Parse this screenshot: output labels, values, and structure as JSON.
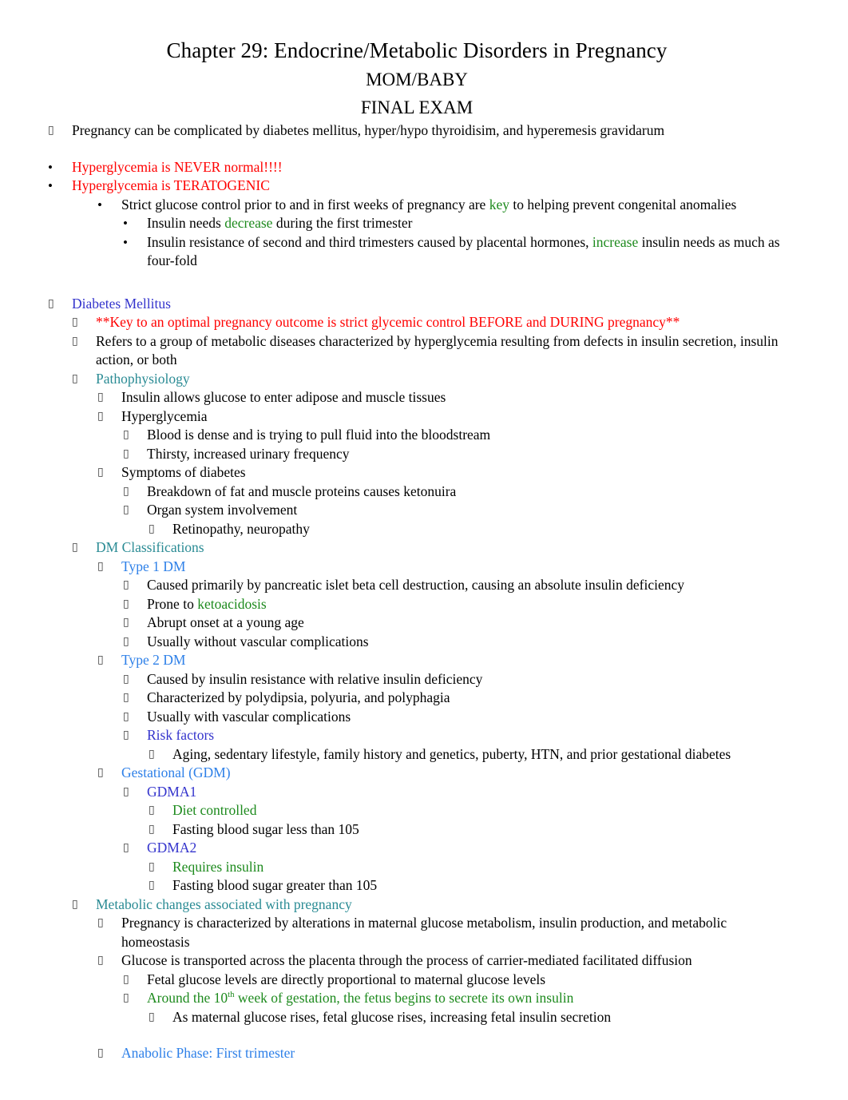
{
  "document": {
    "title_lines": [
      "Chapter 29: Endocrine/Metabolic Disorders in Pregnancy",
      "MOM/BABY",
      "FINAL EXAM"
    ]
  },
  "colors": {
    "red": "#ff0000",
    "green": "#1d8a1d",
    "blue": "#3333cc",
    "light_blue": "#2e80e8",
    "teal": "#2a8b94",
    "black": "#000000",
    "background": "#ffffff"
  },
  "markers": {
    "tofu": "▯",
    "dot": "•"
  },
  "outline": {
    "intro": {
      "text": "Pregnancy can be complicated by diabetes mellitus, hyper/hypo thyroidisim, and hyperemesis gravidarum"
    },
    "hyperglycemia": {
      "never_normal": "Hyperglycemia is NEVER normal!!!!",
      "teratogenic": "Hyperglycemia is TERATOGENIC",
      "strict_control_a": "Strict glucose control prior to and in first weeks of pregnancy are ",
      "strict_control_key": "key",
      "strict_control_b": " to helping prevent congenital anomalies",
      "insulin_needs_a": "Insulin needs ",
      "insulin_needs_decrease": "decrease",
      "insulin_needs_b": "  during the first trimester",
      "insulin_resistance_a": "Insulin resistance of second and third trimesters caused by placental hormones,  ",
      "insulin_resistance_increase": " increase",
      "insulin_resistance_b": " insulin needs as much as four-fold"
    },
    "diabetes_mellitus": {
      "heading": "Diabetes Mellitus",
      "key_note": "**Key to an optimal pregnancy outcome is strict glycemic control BEFORE and DURING pregnancy**",
      "refers_to": "Refers to a group of metabolic diseases characterized by hyperglycemia resulting from defects in insulin secretion, insulin action, or both",
      "pathophysiology": {
        "heading": "Pathophysiology",
        "insulin_glucose": "Insulin allows glucose to enter adipose and muscle tissues",
        "hyperglycemia": "Hyperglycemia",
        "blood_dense": "Blood is dense and is trying to pull fluid into the bloodstream",
        "thirsty": "Thirsty, increased urinary frequency",
        "symptoms_heading": "Symptoms of diabetes",
        "breakdown": "Breakdown of fat and muscle proteins causes ketonuira",
        "organ_system": "Organ system involvement",
        "retinopathy": "Retinopathy, neuropathy"
      },
      "classifications": {
        "heading": "DM Classifications",
        "type1": {
          "heading": "Type 1 DM",
          "items": [
            "Caused primarily by pancreatic islet beta cell destruction, causing an absolute insulin deficiency",
            "Abrupt onset at a young age",
            "Usually without vascular complications"
          ],
          "prone_to_a": "Prone to ",
          "prone_to_green": " ketoacidosis"
        },
        "type2": {
          "heading": "Type 2 DM",
          "items": [
            "Caused by insulin resistance with relative insulin deficiency",
            "Characterized by polydipsia, polyuria, and polyphagia",
            "Usually with vascular complications"
          ],
          "risk_factors_heading": "Risk factors",
          "risk_factors_detail": "Aging, sedentary lifestyle, family history and genetics, puberty, HTN, and prior gestational diabetes"
        },
        "gestational": {
          "heading": "Gestational (GDM)",
          "gdma1": {
            "heading": "GDMA1",
            "controlled": "Diet controlled",
            "fasting": "Fasting blood sugar less than 105"
          },
          "gdma2": {
            "heading": "GDMA2",
            "controlled": "Requires insulin",
            "fasting": "Fasting blood sugar greater than 105"
          }
        }
      },
      "metabolic_changes": {
        "heading": "Metabolic changes associated with pregnancy",
        "alterations": "Pregnancy is characterized by alterations in maternal glucose metabolism, insulin production, and metabolic homeostasis",
        "transport": "Glucose is transported across the placenta through the process of carrier-mediated facilitated diffusion",
        "fetal_levels": "Fetal glucose levels are directly proportional to maternal glucose levels",
        "week_10_a": "Around the 10",
        "week_10_sup": "th",
        "week_10_b": " week of gestation, the fetus begins to secrete its own insulin",
        "maternal_rises": "As maternal glucose rises, fetal glucose rises, increasing fetal insulin secretion",
        "anabolic_phase": "Anabolic Phase: First trimester"
      }
    }
  }
}
